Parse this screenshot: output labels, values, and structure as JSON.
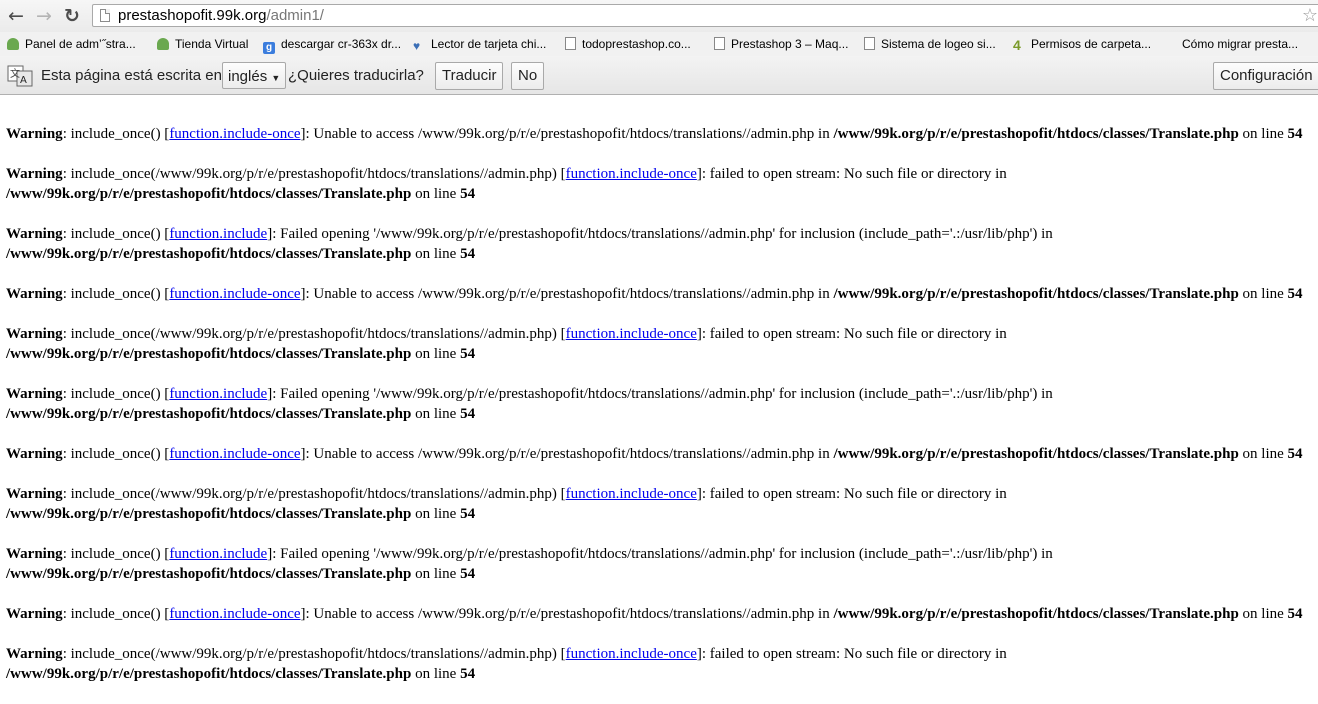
{
  "browser": {
    "nav": {
      "back_icon": "←",
      "forward_icon": "→",
      "reload_icon": "↻"
    },
    "url": {
      "host": "prestashopofit.99k.org",
      "path": "/admin1/"
    },
    "star_icon": "☆",
    "bookmarks": [
      {
        "label": "Panel de adm’˝stra...",
        "icon": "prestashop-icon"
      },
      {
        "label": "Tienda Virtual",
        "icon": "prestashop-icon"
      },
      {
        "label": "descargar cr-363x dr...",
        "icon": "google-icon"
      },
      {
        "label": "Lector de tarjeta chi...",
        "icon": "heart-icon"
      },
      {
        "label": "todoprestashop.co...",
        "icon": "page-icon"
      },
      {
        "label": "Prestashop 3 – Maq...",
        "icon": "page-icon"
      },
      {
        "label": "Sistema de logeo si...",
        "icon": "page-icon"
      },
      {
        "label": "Permisos de carpeta...",
        "icon": "four-icon"
      },
      {
        "label": "Cómo migrar presta...",
        "icon": ""
      }
    ],
    "translate_bar": {
      "text_before": "Esta página está escrita en",
      "language": "inglés",
      "question": "¿Quieres traducirla?",
      "translate_button": "Traducir",
      "no_button": "No",
      "config_button": "Configuración"
    }
  },
  "page": {
    "warning_label": "Warning",
    "messages": [
      {
        "pre": ": include_once() [",
        "link": "function.include-once",
        "post": "]: Unable to access /www/99k.org/p/r/e/prestashopofit/htdocs/translations//admin.php in ",
        "file": "/www/99k.org/p/r/e/prestashopofit/htdocs/classes/Translate.php",
        "on_line": " on line ",
        "line": "54"
      },
      {
        "pre": ": include_once(/www/99k.org/p/r/e/prestashopofit/htdocs/translations//admin.php) [",
        "link": "function.include-once",
        "post": "]: failed to open stream: No such file or directory in",
        "file": "/www/99k.org/p/r/e/prestashopofit/htdocs/classes/Translate.php",
        "on_line": " on line ",
        "line": "54"
      },
      {
        "pre": ": include_once() [",
        "link": "function.include",
        "post": "]: Failed opening '/www/99k.org/p/r/e/prestashopofit/htdocs/translations//admin.php' for inclusion (include_path='.:/usr/lib/php') in",
        "file": "/www/99k.org/p/r/e/prestashopofit/htdocs/classes/Translate.php",
        "on_line": " on line ",
        "line": "54"
      },
      {
        "pre": ": include_once() [",
        "link": "function.include-once",
        "post": "]: Unable to access /www/99k.org/p/r/e/prestashopofit/htdocs/translations//admin.php in ",
        "file": "/www/99k.org/p/r/e/prestashopofit/htdocs/classes/Translate.php",
        "on_line": " on line ",
        "line": "54"
      },
      {
        "pre": ": include_once(/www/99k.org/p/r/e/prestashopofit/htdocs/translations//admin.php) [",
        "link": "function.include-once",
        "post": "]: failed to open stream: No such file or directory in",
        "file": "/www/99k.org/p/r/e/prestashopofit/htdocs/classes/Translate.php",
        "on_line": " on line ",
        "line": "54"
      },
      {
        "pre": ": include_once() [",
        "link": "function.include",
        "post": "]: Failed opening '/www/99k.org/p/r/e/prestashopofit/htdocs/translations//admin.php' for inclusion (include_path='.:/usr/lib/php') in",
        "file": "/www/99k.org/p/r/e/prestashopofit/htdocs/classes/Translate.php",
        "on_line": " on line ",
        "line": "54"
      },
      {
        "pre": ": include_once() [",
        "link": "function.include-once",
        "post": "]: Unable to access /www/99k.org/p/r/e/prestashopofit/htdocs/translations//admin.php in ",
        "file": "/www/99k.org/p/r/e/prestashopofit/htdocs/classes/Translate.php",
        "on_line": " on line ",
        "line": "54"
      },
      {
        "pre": ": include_once(/www/99k.org/p/r/e/prestashopofit/htdocs/translations//admin.php) [",
        "link": "function.include-once",
        "post": "]: failed to open stream: No such file or directory in",
        "file": "/www/99k.org/p/r/e/prestashopofit/htdocs/classes/Translate.php",
        "on_line": " on line ",
        "line": "54"
      },
      {
        "pre": ": include_once() [",
        "link": "function.include",
        "post": "]: Failed opening '/www/99k.org/p/r/e/prestashopofit/htdocs/translations//admin.php' for inclusion (include_path='.:/usr/lib/php') in",
        "file": "/www/99k.org/p/r/e/prestashopofit/htdocs/classes/Translate.php",
        "on_line": " on line ",
        "line": "54"
      },
      {
        "pre": ": include_once() [",
        "link": "function.include-once",
        "post": "]: Unable to access /www/99k.org/p/r/e/prestashopofit/htdocs/translations//admin.php in ",
        "file": "/www/99k.org/p/r/e/prestashopofit/htdocs/classes/Translate.php",
        "on_line": " on line ",
        "line": "54"
      },
      {
        "pre": ": include_once(/www/99k.org/p/r/e/prestashopofit/htdocs/translations//admin.php) [",
        "link": "function.include-once",
        "post": "]: failed to open stream: No such file or directory in",
        "file": "/www/99k.org/p/r/e/prestashopofit/htdocs/classes/Translate.php",
        "on_line": " on line ",
        "line": "54"
      }
    ]
  }
}
